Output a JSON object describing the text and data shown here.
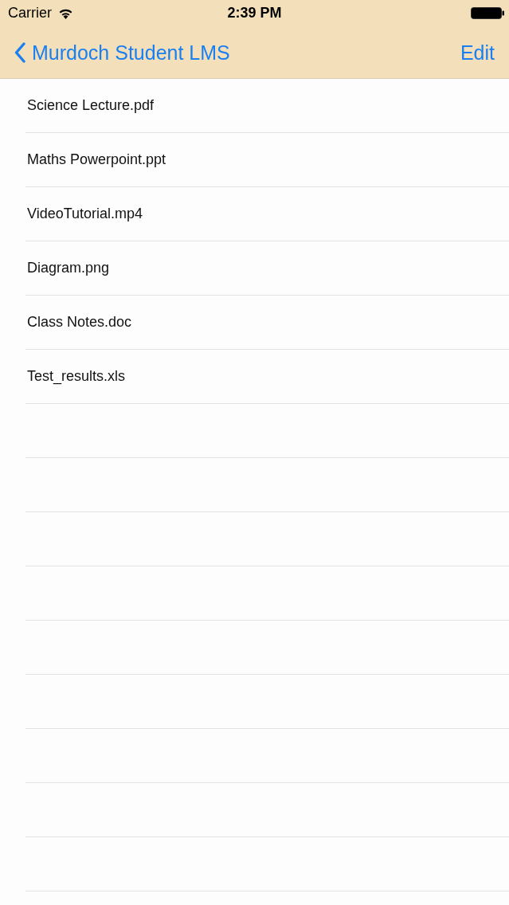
{
  "status_bar": {
    "carrier": "Carrier",
    "time": "2:39 PM"
  },
  "nav_bar": {
    "back_label": "Murdoch Student LMS",
    "action": "Edit"
  },
  "files": [
    "Science Lecture.pdf",
    "Maths Powerpoint.ppt",
    "VideoTutorial.mp4",
    "Diagram.png",
    "Class Notes.doc",
    "Test_results.xls"
  ]
}
